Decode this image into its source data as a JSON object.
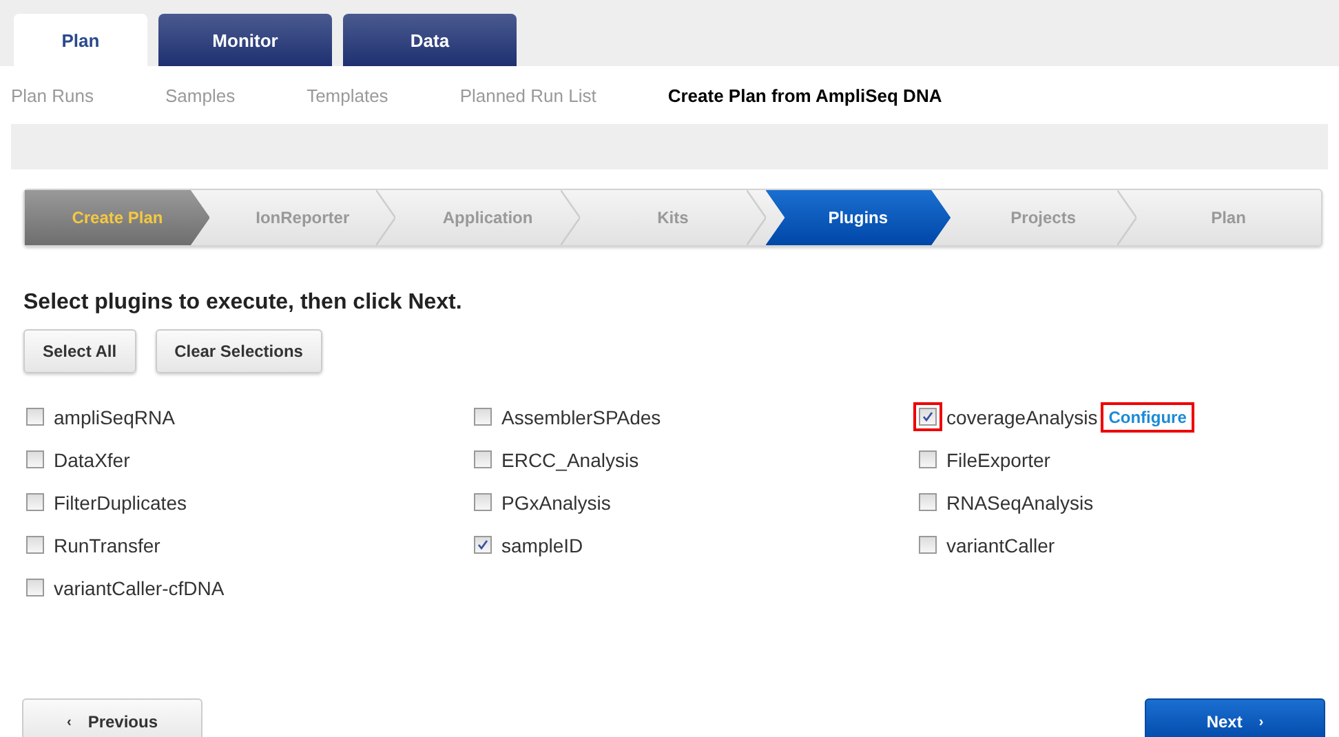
{
  "tabs": [
    {
      "label": "Plan",
      "selected": true
    },
    {
      "label": "Monitor",
      "selected": false
    },
    {
      "label": "Data",
      "selected": false
    }
  ],
  "subnav": [
    {
      "label": "Plan Runs",
      "selected": false
    },
    {
      "label": "Samples",
      "selected": false
    },
    {
      "label": "Templates",
      "selected": false
    },
    {
      "label": "Planned Run List",
      "selected": false
    },
    {
      "label": "Create Plan from AmpliSeq DNA",
      "selected": true
    }
  ],
  "wizard_steps": [
    {
      "label": "Create Plan",
      "completed": true,
      "selected": false
    },
    {
      "label": "IonReporter",
      "completed": false,
      "selected": false
    },
    {
      "label": "Application",
      "completed": false,
      "selected": false
    },
    {
      "label": "Kits",
      "completed": false,
      "selected": false
    },
    {
      "label": "Plugins",
      "completed": false,
      "selected": true
    },
    {
      "label": "Projects",
      "completed": false,
      "selected": false
    },
    {
      "label": "Plan",
      "completed": false,
      "selected": false
    }
  ],
  "heading": "Select plugins to execute, then click Next.",
  "selection_buttons": [
    "Select All",
    "Clear Selections"
  ],
  "plugins": [
    {
      "name": "ampliSeqRNA",
      "checked": false,
      "highlighted": false
    },
    {
      "name": "AssemblerSPAdes",
      "checked": false,
      "highlighted": false
    },
    {
      "name": "coverageAnalysis",
      "checked": true,
      "highlighted": true,
      "configure": {
        "label": "Configure",
        "highlighted": true
      }
    },
    {
      "name": "DataXfer",
      "checked": false,
      "highlighted": false
    },
    {
      "name": "ERCC_Analysis",
      "checked": false,
      "highlighted": false
    },
    {
      "name": "FileExporter",
      "checked": false,
      "highlighted": false
    },
    {
      "name": "FilterDuplicates",
      "checked": false,
      "highlighted": false
    },
    {
      "name": "PGxAnalysis",
      "checked": false,
      "highlighted": false
    },
    {
      "name": "RNASeqAnalysis",
      "checked": false,
      "highlighted": false
    },
    {
      "name": "RunTransfer",
      "checked": false,
      "highlighted": false
    },
    {
      "name": "sampleID",
      "checked": true,
      "highlighted": false
    },
    {
      "name": "variantCaller",
      "checked": false,
      "highlighted": false
    },
    {
      "name": "variantCaller-cfDNA",
      "checked": false,
      "highlighted": false
    }
  ],
  "footer": {
    "previous": {
      "arrow": "‹",
      "label": "Previous"
    },
    "next": {
      "label": "Next",
      "arrow": "›"
    }
  }
}
